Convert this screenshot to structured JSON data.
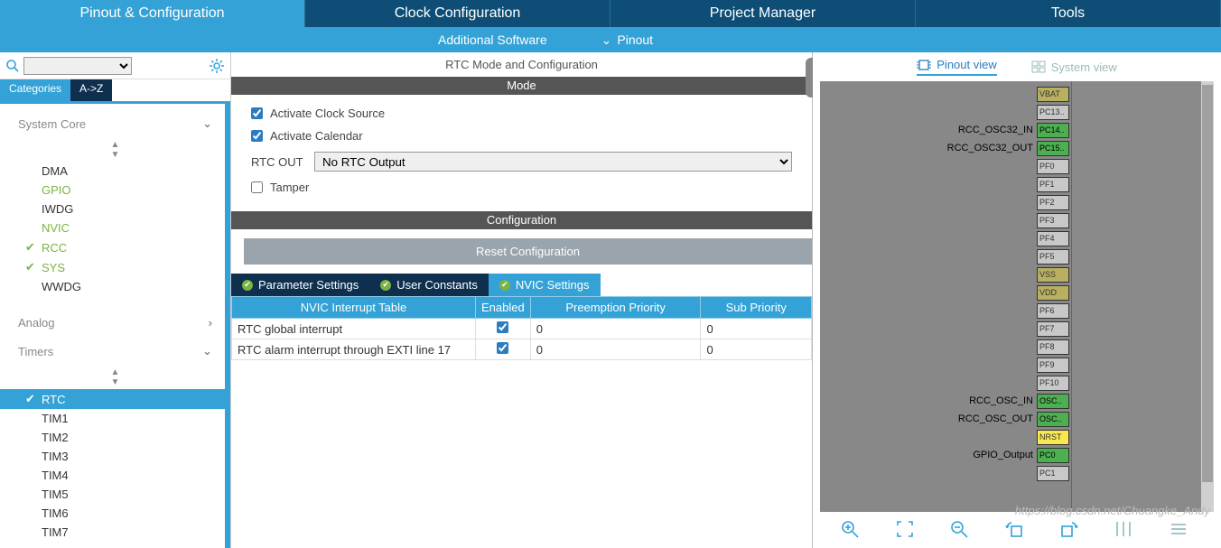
{
  "top_tabs": {
    "pinout": "Pinout & Configuration",
    "clock": "Clock Configuration",
    "project": "Project Manager",
    "tools": "Tools"
  },
  "sub_bar": {
    "additional": "Additional Software",
    "pinout": "Pinout"
  },
  "sidebar": {
    "cat_tab": "Categories",
    "az_tab": "A->Z",
    "groups": {
      "system_core": {
        "label": "System Core",
        "items": [
          "DMA",
          "GPIO",
          "IWDG",
          "NVIC",
          "RCC",
          "SYS",
          "WWDG"
        ]
      },
      "analog": {
        "label": "Analog"
      },
      "timers": {
        "label": "Timers",
        "items": [
          "RTC",
          "TIM1",
          "TIM2",
          "TIM3",
          "TIM4",
          "TIM5",
          "TIM6",
          "TIM7"
        ]
      }
    }
  },
  "mid": {
    "title": "RTC Mode and Configuration",
    "mode_label": "Mode",
    "activate_clock": "Activate Clock Source",
    "activate_calendar": "Activate Calendar",
    "rtc_out_label": "RTC OUT",
    "rtc_out_value": "No RTC Output",
    "tamper": "Tamper",
    "config_label": "Configuration",
    "reset": "Reset Configuration",
    "tabs": {
      "param": "Parameter Settings",
      "user": "User Constants",
      "nvic": "NVIC Settings"
    },
    "table": {
      "h1": "NVIC Interrupt Table",
      "h2": "Enabled",
      "h3": "Preemption Priority",
      "h4": "Sub Priority",
      "rows": [
        {
          "name": "RTC global interrupt",
          "enabled": true,
          "preempt": "0",
          "sub": "0"
        },
        {
          "name": "RTC alarm interrupt through EXTI line 17",
          "enabled": true,
          "preempt": "0",
          "sub": "0"
        }
      ]
    }
  },
  "right": {
    "pinout_view": "Pinout view",
    "system_view": "System view",
    "pins": [
      {
        "label": "",
        "box": "VBAT",
        "cls": "khaki"
      },
      {
        "label": "",
        "box": "PC13..",
        "cls": "gray"
      },
      {
        "label": "RCC_OSC32_IN",
        "box": "PC14..",
        "cls": "green"
      },
      {
        "label": "RCC_OSC32_OUT",
        "box": "PC15..",
        "cls": "green"
      },
      {
        "label": "",
        "box": "PF0",
        "cls": "gray"
      },
      {
        "label": "",
        "box": "PF1",
        "cls": "gray"
      },
      {
        "label": "",
        "box": "PF2",
        "cls": "gray"
      },
      {
        "label": "",
        "box": "PF3",
        "cls": "gray"
      },
      {
        "label": "",
        "box": "PF4",
        "cls": "gray"
      },
      {
        "label": "",
        "box": "PF5",
        "cls": "gray"
      },
      {
        "label": "",
        "box": "VSS",
        "cls": "khaki"
      },
      {
        "label": "",
        "box": "VDD",
        "cls": "khaki"
      },
      {
        "label": "",
        "box": "PF6",
        "cls": "gray"
      },
      {
        "label": "",
        "box": "PF7",
        "cls": "gray"
      },
      {
        "label": "",
        "box": "PF8",
        "cls": "gray"
      },
      {
        "label": "",
        "box": "PF9",
        "cls": "gray"
      },
      {
        "label": "",
        "box": "PF10",
        "cls": "gray"
      },
      {
        "label": "RCC_OSC_IN",
        "box": "OSC..",
        "cls": "green"
      },
      {
        "label": "RCC_OSC_OUT",
        "box": "OSC..",
        "cls": "green"
      },
      {
        "label": "",
        "box": "NRST",
        "cls": "yellow"
      },
      {
        "label": "GPIO_Output",
        "box": "PC0",
        "cls": "green"
      },
      {
        "label": "",
        "box": "PC1",
        "cls": "gray"
      }
    ]
  },
  "watermark": "https://blog.csdn.net/Chuangke_Andy"
}
